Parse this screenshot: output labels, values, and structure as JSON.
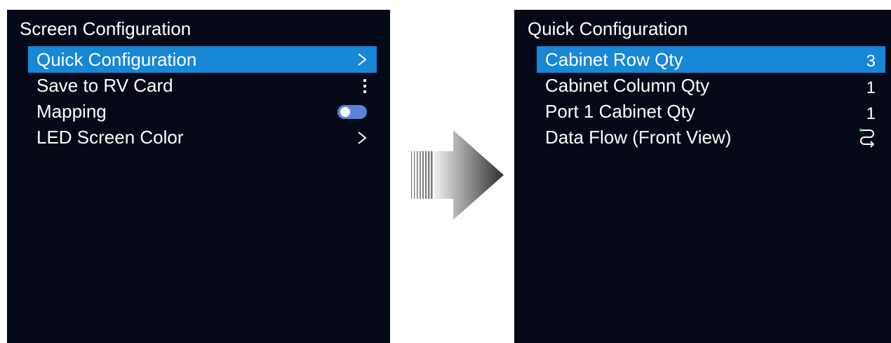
{
  "left_screen": {
    "title": "Screen Configuration",
    "items": [
      {
        "label": "Quick Configuration",
        "indicator": "chevron-right-icon"
      },
      {
        "label": "Save to RV Card",
        "indicator": "kebab-menu-icon"
      },
      {
        "label": "Mapping",
        "indicator": "toggle-switch",
        "toggle_state": "off"
      },
      {
        "label": "LED Screen Color",
        "indicator": "chevron-right-icon"
      }
    ],
    "selected_index": 0
  },
  "right_screen": {
    "title": "Quick Configuration",
    "items": [
      {
        "label": "Cabinet Row Qty",
        "value": "3"
      },
      {
        "label": "Cabinet Column Qty",
        "value": "1"
      },
      {
        "label": "Port 1 Cabinet Qty",
        "value": "1"
      },
      {
        "label": "Data Flow (Front View)",
        "indicator": "data-flow-icon"
      }
    ],
    "selected_index": 0
  },
  "colors": {
    "screen_background": "#050816",
    "highlight": "#1787d6",
    "toggle_track": "#5b84d8",
    "flow_start_dot": "#4cc552"
  }
}
